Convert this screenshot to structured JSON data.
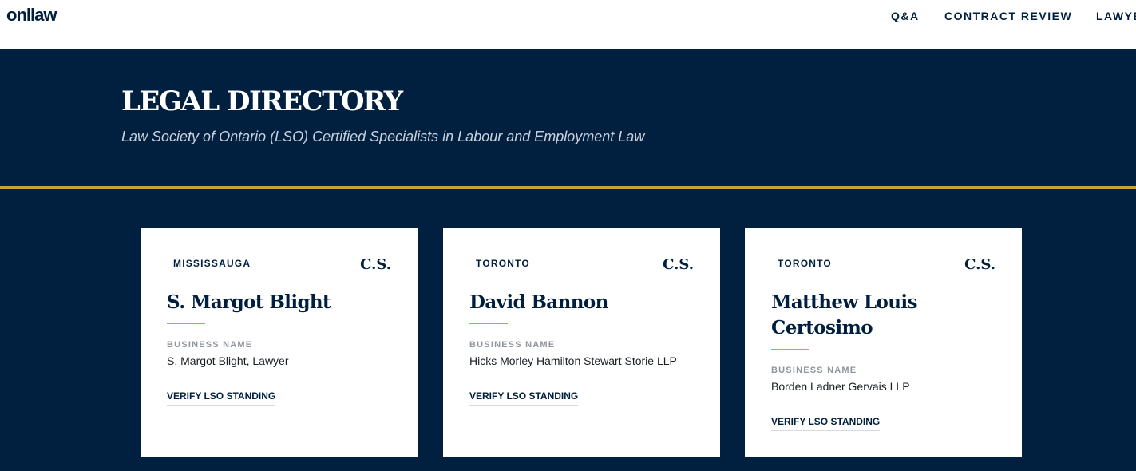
{
  "header": {
    "logo": "onllaw",
    "nav": [
      {
        "label": "Q&A"
      },
      {
        "label": "CONTRACT REVIEW"
      },
      {
        "label": "LAWYERS"
      }
    ]
  },
  "hero": {
    "title": "LEGAL DIRECTORY",
    "subtitle": "Law Society of Ontario (LSO) Certified Specialists in Labour and Employment Law"
  },
  "cards": [
    {
      "city": "MISSISSAUGA",
      "badge": "C.S.",
      "name": "S. Margot Blight",
      "business_label": "BUSINESS NAME",
      "business_name": "S. Margot Blight, Lawyer",
      "link": "VERIFY LSO STANDING"
    },
    {
      "city": "TORONTO",
      "badge": "C.S.",
      "name": "David Bannon",
      "business_label": "BUSINESS NAME",
      "business_name": "Hicks Morley Hamilton Stewart Storie LLP",
      "link": "VERIFY LSO STANDING"
    },
    {
      "city": "TORONTO",
      "badge": "C.S.",
      "name": "Matthew Louis Certosimo",
      "business_label": "BUSINESS NAME",
      "business_name": "Borden Ladner Gervais LLP",
      "link": "VERIFY LSO STANDING"
    }
  ],
  "colors": {
    "navy": "#011f3f",
    "gold": "#c9a33a",
    "white": "#ffffff"
  }
}
